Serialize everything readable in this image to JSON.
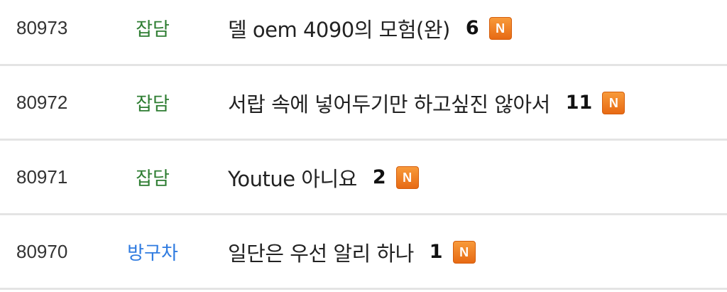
{
  "colors": {
    "category_green": "#2e7d32",
    "category_blue": "#2f7be0",
    "badge_orange": "#f07f23"
  },
  "posts": [
    {
      "number": "80973",
      "category": "잡담",
      "category_color": "#2e7d32",
      "title": "델 oem 4090의 모험(완)",
      "comments": "6",
      "badge": "N"
    },
    {
      "number": "80972",
      "category": "잡담",
      "category_color": "#2e7d32",
      "title": "서랍 속에 넣어두기만 하고싶진 않아서",
      "comments": "11",
      "badge": "N"
    },
    {
      "number": "80971",
      "category": "잡담",
      "category_color": "#2e7d32",
      "title": "Youtue 아니요",
      "comments": "2",
      "badge": "N"
    },
    {
      "number": "80970",
      "category": "방구차",
      "category_color": "#2f7be0",
      "title": "일단은 우선 알리 하나",
      "comments": "1",
      "badge": "N"
    }
  ]
}
